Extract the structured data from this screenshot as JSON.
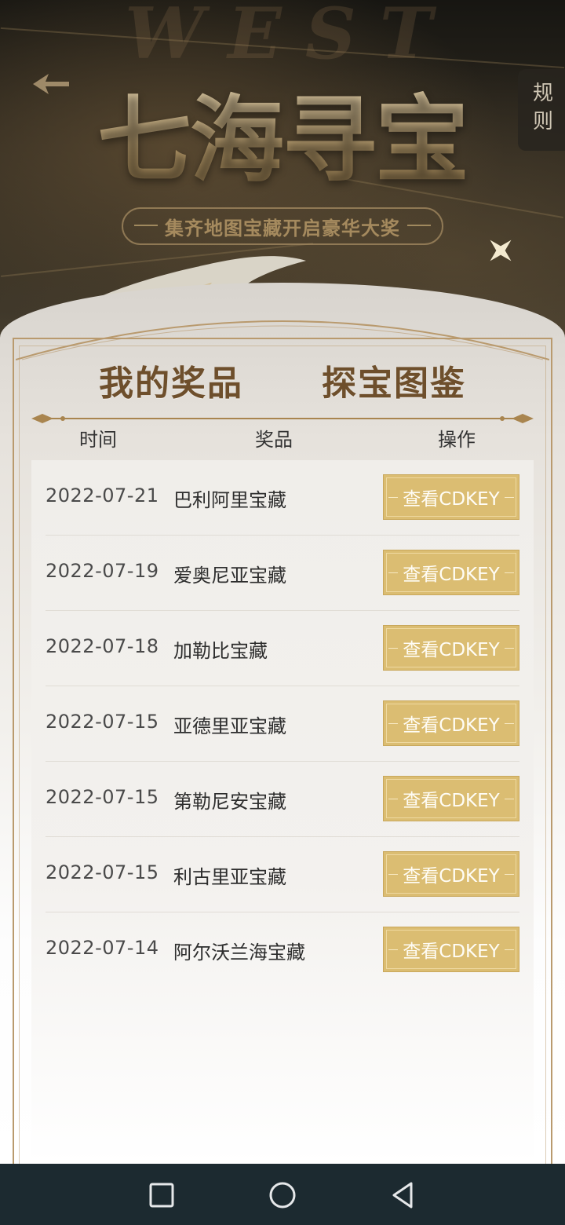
{
  "header": {
    "title": "七海寻宝",
    "subtitle": "集齐地图宝藏开启豪华大奖",
    "rules_label": "规则"
  },
  "tabs": [
    {
      "label": "我的奖品",
      "active": true
    },
    {
      "label": "探宝图鉴",
      "active": false
    }
  ],
  "table": {
    "headers": [
      "时间",
      "奖品",
      "操作"
    ],
    "rows": [
      {
        "date": "2022-07-21",
        "prize": "巴利阿里宝藏",
        "action": "查看CDKEY"
      },
      {
        "date": "2022-07-19",
        "prize": "爱奥尼亚宝藏",
        "action": "查看CDKEY"
      },
      {
        "date": "2022-07-18",
        "prize": "加勒比宝藏",
        "action": "查看CDKEY"
      },
      {
        "date": "2022-07-15",
        "prize": "亚德里亚宝藏",
        "action": "查看CDKEY"
      },
      {
        "date": "2022-07-15",
        "prize": "第勒尼安宝藏",
        "action": "查看CDKEY"
      },
      {
        "date": "2022-07-15",
        "prize": "利古里亚宝藏",
        "action": "查看CDKEY"
      },
      {
        "date": "2022-07-14",
        "prize": "阿尔沃兰海宝藏",
        "action": "查看CDKEY"
      }
    ]
  },
  "icons": {
    "close": "close-star-icon",
    "nav_recent": "square-icon",
    "nav_home": "circle-icon",
    "nav_back": "triangle-back-icon"
  },
  "colors": {
    "accent_gold": "#dbbd72",
    "tab_brown": "#6e4f2c",
    "navbar": "#1c2a30"
  }
}
